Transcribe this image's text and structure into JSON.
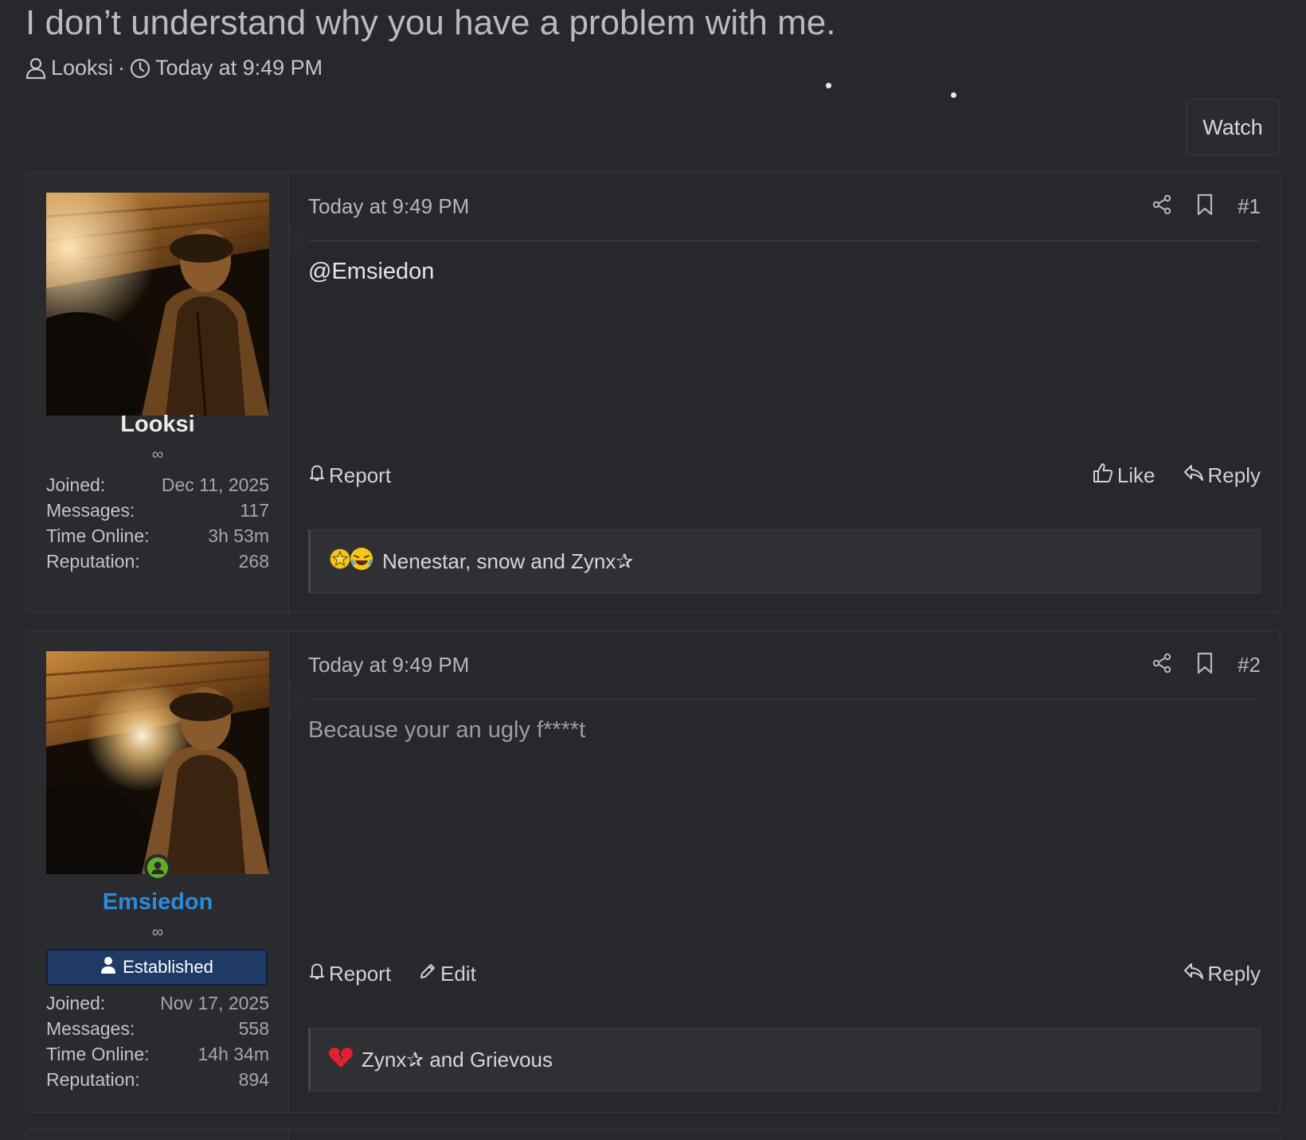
{
  "thread": {
    "title": "I don’t understand why you have a problem with me.",
    "author": "Looksi",
    "separator": "·",
    "date": "Today at 9:49 PM",
    "watch_label": "Watch"
  },
  "colors": {
    "background": "#27282c",
    "username_default": "#ebebec",
    "username_highlight": "#2a8bd8",
    "role_badge": "#1f3a66",
    "online_badge": "#5fae2b",
    "broken_heart": "#e32030"
  },
  "posts": [
    {
      "user": {
        "name": "Looksi",
        "title": "∞",
        "stats": [
          {
            "label": "Joined:",
            "value": "Dec 11, 2025"
          },
          {
            "label": "Messages:",
            "value": "117"
          },
          {
            "label": "Time Online:",
            "value": "3h 53m"
          },
          {
            "label": "Reputation:",
            "value": "268"
          }
        ]
      },
      "date": "Today at 9:49 PM",
      "number": "#1",
      "body": "@Emsiedon",
      "actions": {
        "report": "Report",
        "like": "Like",
        "reply": "Reply"
      },
      "reactions": {
        "icons": [
          "star-face-emoji",
          "laughing-emoji"
        ],
        "text": "Nenestar, snow and Zynx✰"
      }
    },
    {
      "user": {
        "name": "Emsiedon",
        "title": "∞",
        "online": true,
        "role": "Established",
        "stats": [
          {
            "label": "Joined:",
            "value": "Nov 17, 2025"
          },
          {
            "label": "Messages:",
            "value": "558"
          },
          {
            "label": "Time Online:",
            "value": "14h 34m"
          },
          {
            "label": "Reputation:",
            "value": "894"
          }
        ]
      },
      "date": "Today at 9:49 PM",
      "number": "#2",
      "body": "Because your an ugly f****t",
      "actions": {
        "report": "Report",
        "edit": "Edit",
        "reply": "Reply"
      },
      "reactions": {
        "icons": [
          "broken-heart-emoji"
        ],
        "text": "Zynx✰ and Grievous"
      }
    }
  ]
}
